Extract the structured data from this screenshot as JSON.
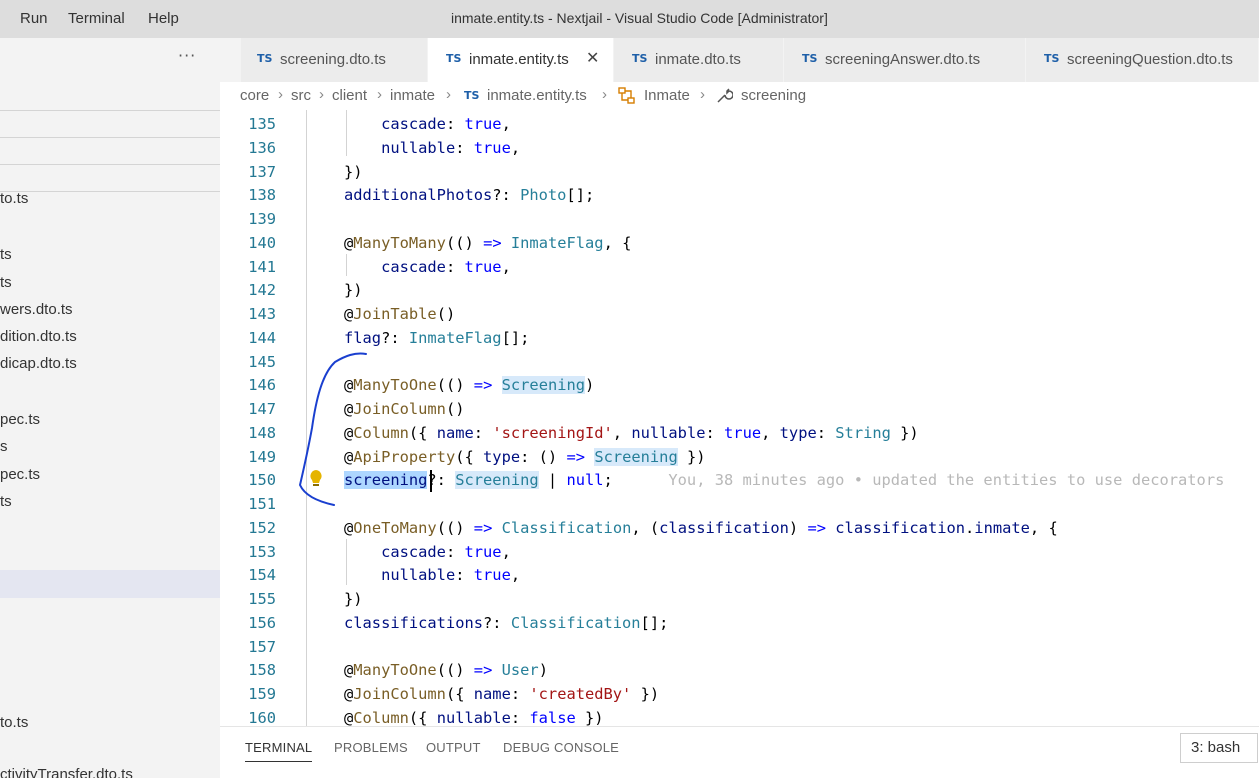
{
  "menu": {
    "run": "Run",
    "terminal": "Terminal",
    "help": "Help"
  },
  "window_title": "inmate.entity.ts - Nextjail - Visual Studio Code [Administrator]",
  "sidebar": {
    "more": "···",
    "items": [
      "to.ts",
      "ts",
      "ts",
      "wers.dto.ts",
      "dition.dto.ts",
      "dicap.dto.ts",
      "pec.ts",
      "s",
      "pec.ts",
      "ts",
      "to.ts",
      "ctivityTransfer.dto.ts"
    ]
  },
  "tabs": [
    {
      "icon": "TS",
      "label": "screening.dto.ts"
    },
    {
      "icon": "TS",
      "label": "inmate.entity.ts",
      "close": "✕"
    },
    {
      "icon": "TS",
      "label": "inmate.dto.ts"
    },
    {
      "icon": "TS",
      "label": "screeningAnswer.dto.ts"
    },
    {
      "icon": "TS",
      "label": "screeningQuestion.dto.ts"
    }
  ],
  "breadcrumb": {
    "core": "core",
    "src": "src",
    "client": "client",
    "inmate": "inmate",
    "file_icon": "TS",
    "file": "inmate.entity.ts",
    "class": "Inmate",
    "property": "screening"
  },
  "editor": {
    "line_numbers": [
      "135",
      "136",
      "137",
      "138",
      "139",
      "140",
      "141",
      "142",
      "143",
      "144",
      "145",
      "146",
      "147",
      "148",
      "149",
      "150",
      "151",
      "152",
      "153",
      "154",
      "155",
      "156",
      "157",
      "158",
      "159",
      "160"
    ],
    "blame": "You, 38 minutes ago • updated the entities to use decorators",
    "tokens": {
      "cascade": "cascade",
      "colon": ": ",
      "true": "true",
      "comma": ",",
      "nullable": "nullable",
      "close_brace_paren": "})",
      "additionalPhotos": "additionalPhotos",
      "optional": "?: ",
      "photo_type": "Photo",
      "arr_end": "[];",
      "ManyToMany": "ManyToMany",
      "at": "@",
      "parens": "()",
      "arrow": "=>",
      "InmateFlag": "InmateFlag",
      "brace_open": ", {",
      "JoinTable": "JoinTable",
      "flag": "flag",
      "ManyToOne": "ManyToOne",
      "Screening": "Screening",
      "JoinColumn": "JoinColumn",
      "Column": "Column",
      "name": "name",
      "screeningId": "'screeningId'",
      "type": "type",
      "String": "String",
      "ApiProperty": "ApiProperty",
      "screening": "screening",
      "null": "null",
      "OneToMany": "OneToMany",
      "Classification": "Classification",
      "classification": "classification",
      "inmate": "inmate",
      "classifications": "classifications",
      "User": "User",
      "createdBy": "'createdBy'",
      "false": "false"
    }
  },
  "panel": {
    "tabs": [
      "TERMINAL",
      "PROBLEMS",
      "OUTPUT",
      "DEBUG CONSOLE"
    ],
    "active_tab": "TERMINAL",
    "terminal_select": "3: bash"
  },
  "colors": {
    "keyword": "#0000ff",
    "type": "#267f99",
    "property": "#001080",
    "string": "#a31515",
    "decorator": "#795e26",
    "line_number": "#237893",
    "annotation_ink": "#1a3fcf",
    "lightbulb": "#e5b400"
  }
}
